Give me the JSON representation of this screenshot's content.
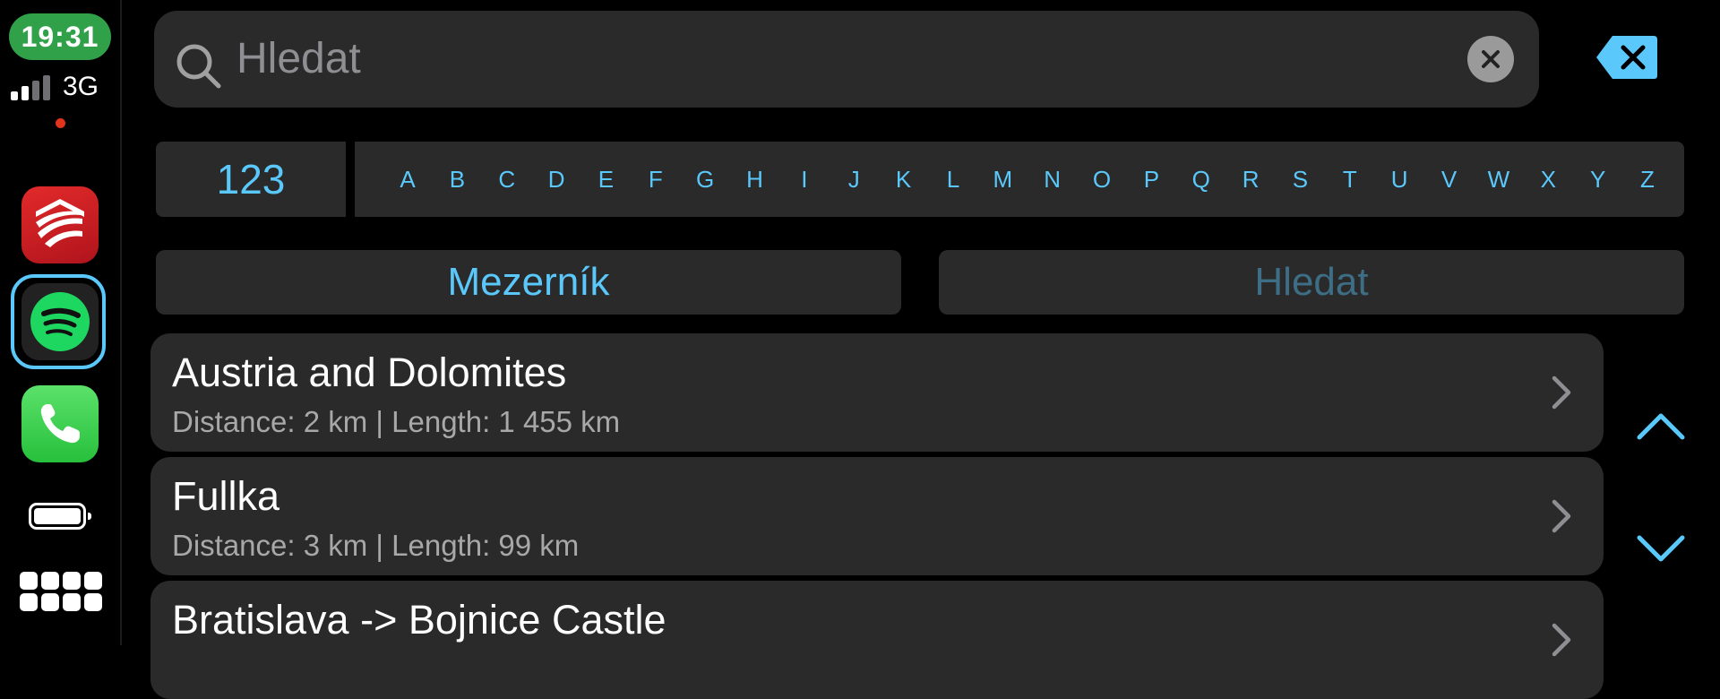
{
  "status": {
    "time": "19:31",
    "network": "3G"
  },
  "dock": {
    "apps": [
      "red-app-icon",
      "spotify-icon",
      "phone-icon"
    ],
    "colors": {
      "time_pill": "#30a149",
      "active_ring": "#5ac8fa",
      "recording_dot": "#e0341b"
    }
  },
  "search": {
    "placeholder": "Hledat"
  },
  "keyboard": {
    "numbers_key": "123",
    "letters": [
      "A",
      "B",
      "C",
      "D",
      "E",
      "F",
      "G",
      "H",
      "I",
      "J",
      "K",
      "L",
      "M",
      "N",
      "O",
      "P",
      "Q",
      "R",
      "S",
      "T",
      "U",
      "V",
      "W",
      "X",
      "Y",
      "Z"
    ],
    "space_label": "Mezerník",
    "search_label": "Hledat"
  },
  "results": [
    {
      "title": "Austria and Dolomites",
      "subtitle": "Distance: 2 km | Length: 1 455 km"
    },
    {
      "title": "Fullka",
      "subtitle": "Distance: 3 km | Length: 99 km"
    },
    {
      "title": "Bratislava -> Bojnice Castle",
      "subtitle": ""
    }
  ],
  "accent_color": "#5ac8fa"
}
